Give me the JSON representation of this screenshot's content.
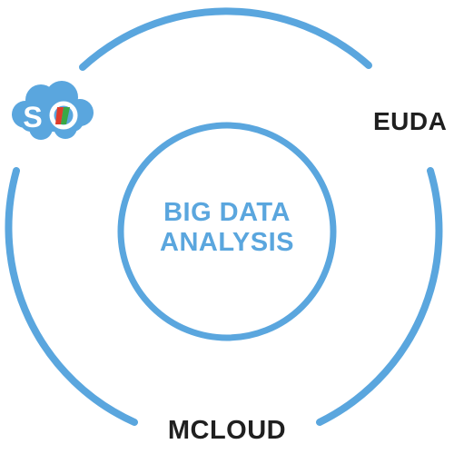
{
  "diagram": {
    "center": {
      "line1": "BIG DATA",
      "line2": "ANALYSIS"
    },
    "nodes": {
      "euda": "EUDA",
      "mcloud": "MCLOUD",
      "logo": "SO"
    }
  },
  "colors": {
    "ring": "#5aa6de",
    "center_text": "#5aa6de",
    "label_text": "#1f1f1f",
    "logo_cloud": "#5aa6de",
    "logo_red": "#e03c2c",
    "logo_green": "#3aa846"
  },
  "icons": [
    "cloud-logo-icon"
  ]
}
